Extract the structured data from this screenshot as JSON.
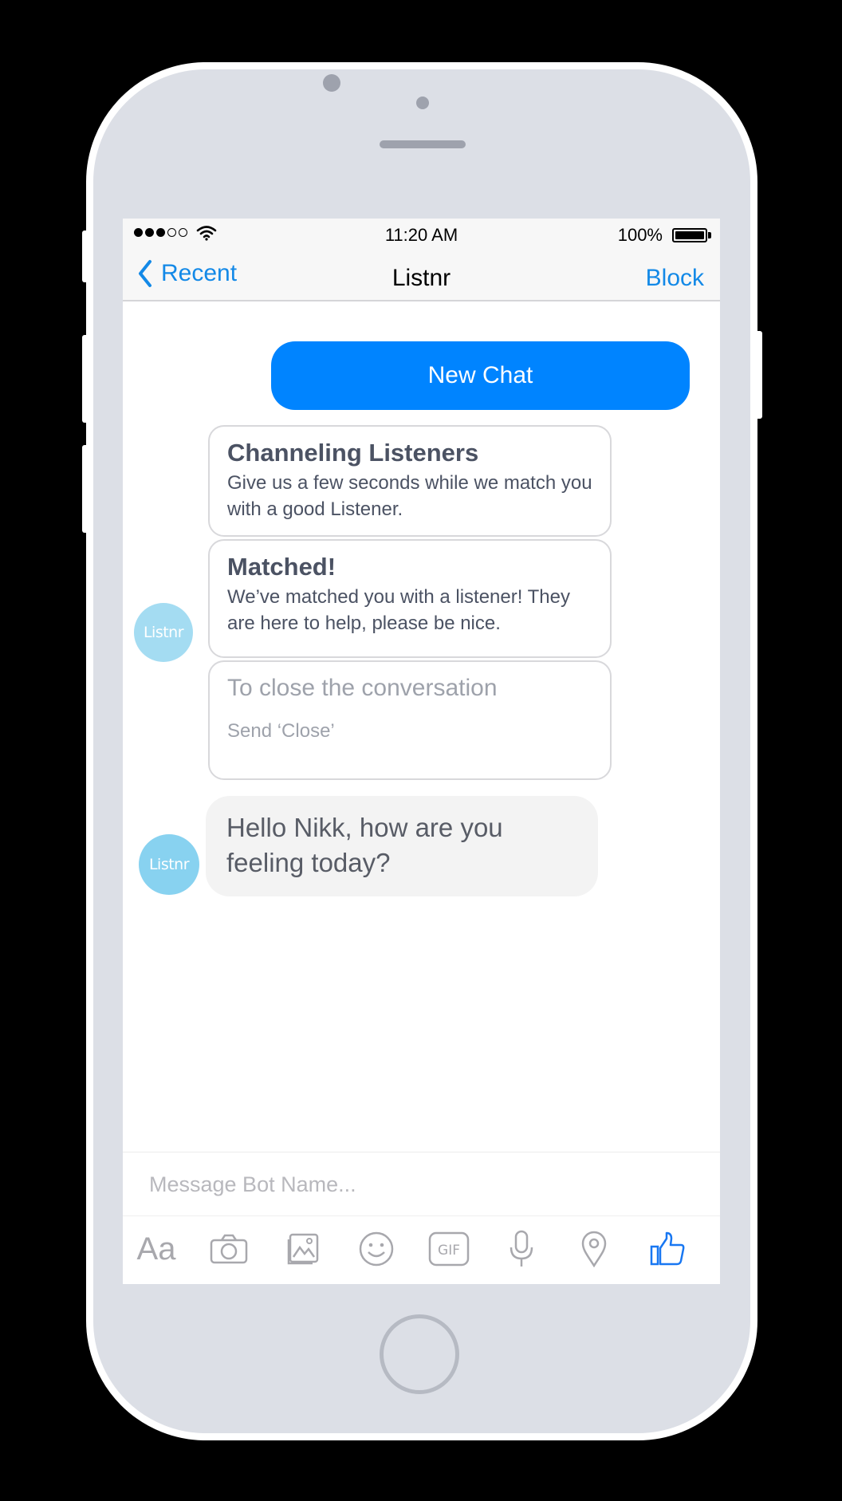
{
  "status": {
    "time": "11:20 AM",
    "battery": "100%"
  },
  "nav": {
    "back_label": "Recent",
    "title": "Listnr",
    "action_label": "Block"
  },
  "actions": {
    "new_chat": "New Chat"
  },
  "cards": [
    {
      "title": "Channeling Listeners",
      "body": "Give us a few seconds while we match you with a good Listener."
    },
    {
      "title": "Matched!",
      "body": "We’ve matched you with a listener! They are here to help, please be nice."
    },
    {
      "title": "To close the conversation",
      "body": "Send ‘Close’"
    }
  ],
  "avatar": {
    "label": "Listnr"
  },
  "message": {
    "text": "Hello Nikk, how are you feeling today?"
  },
  "composer": {
    "placeholder": "Message Bot Name..."
  },
  "toolbar": {
    "aa_label": "Aa",
    "gif_label": "GIF"
  },
  "colors": {
    "accent": "#0084ff",
    "link": "#1389e7",
    "avatar": "#a4dcf2"
  }
}
